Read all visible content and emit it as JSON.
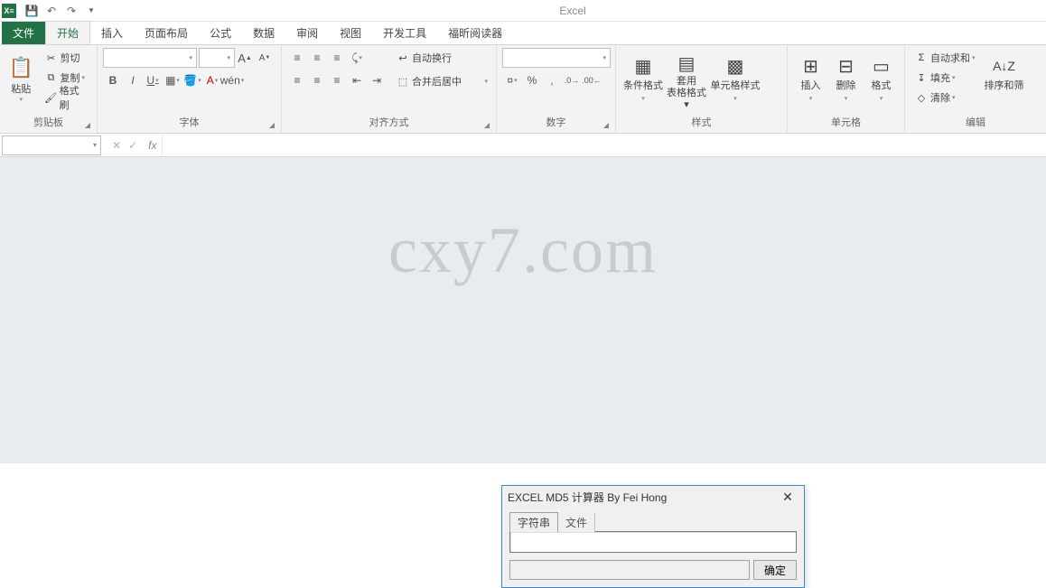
{
  "titlebar": {
    "app_title": "Excel"
  },
  "tabs": {
    "file": "文件",
    "items": [
      "开始",
      "插入",
      "页面布局",
      "公式",
      "数据",
      "审阅",
      "视图",
      "开发工具",
      "福昕阅读器"
    ],
    "active_index": 0
  },
  "ribbon": {
    "clipboard": {
      "paste": "粘贴",
      "cut": "剪切",
      "copy": "复制",
      "painter": "格式刷",
      "label": "剪贴板"
    },
    "font": {
      "grow": "A",
      "shrink": "A",
      "bold": "B",
      "italic": "I",
      "underline": "U",
      "label": "字体"
    },
    "align": {
      "wrap": "自动换行",
      "merge": "合并后居中",
      "label": "对齐方式"
    },
    "number": {
      "percent": "%",
      "comma": ",",
      "inc": ".0",
      "dec": ".00",
      "label": "数字"
    },
    "styles": {
      "cond": "条件格式",
      "table": "套用\n表格格式",
      "cell": "单元格样式",
      "label": "样式"
    },
    "cells": {
      "insert": "插入",
      "delete": "删除",
      "format": "格式",
      "label": "单元格"
    },
    "editing": {
      "sum": "自动求和",
      "fill": "填充",
      "clear": "清除",
      "sort": "排序和筛",
      "label": "编辑"
    }
  },
  "watermark": "cxy7.com",
  "dialog": {
    "title": "EXCEL MD5 计算器 By Fei Hong",
    "tab_string": "字符串",
    "tab_file": "文件",
    "ok": "确定"
  }
}
